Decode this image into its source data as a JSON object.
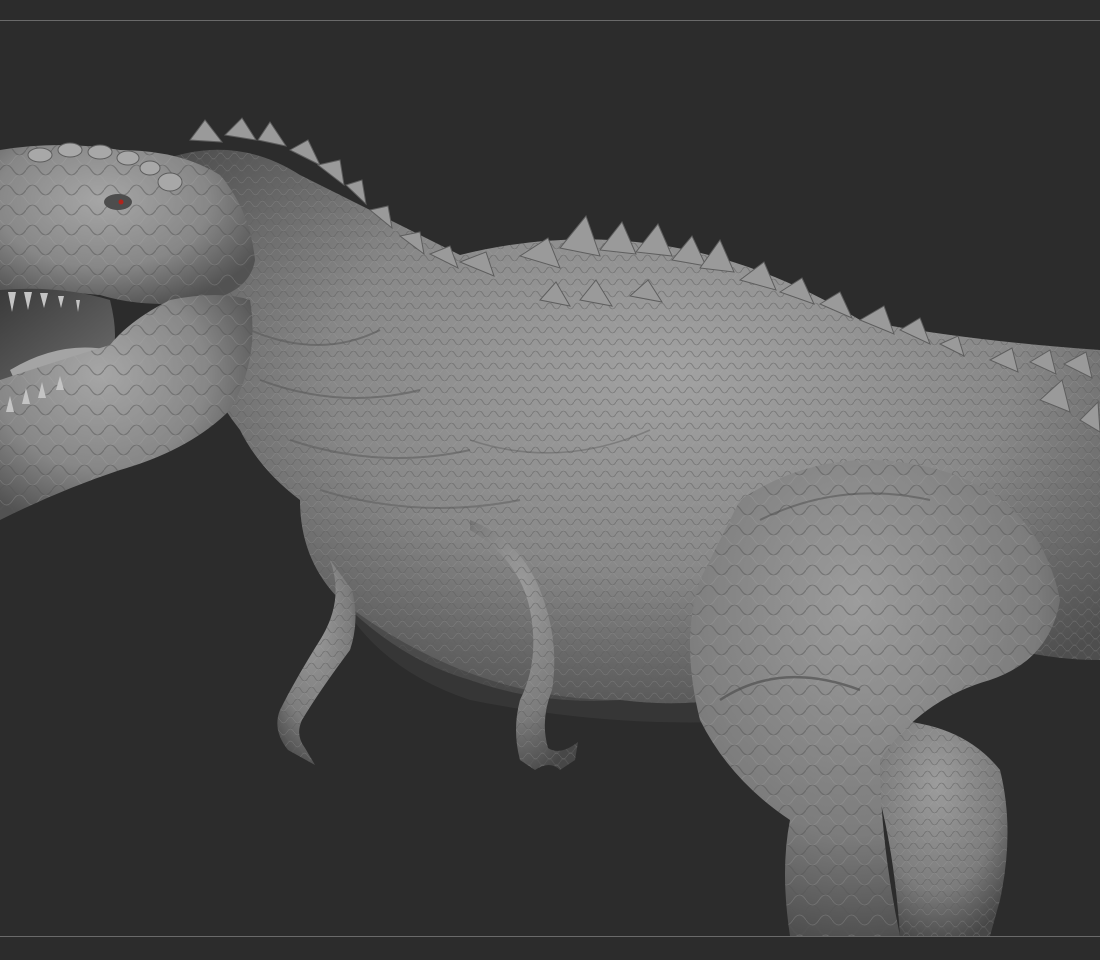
{
  "viewport": {
    "background_color": "#2c2c2c",
    "frame_line_color": "#6a6a6a"
  },
  "model": {
    "subject": "t-rex-sculpt",
    "material_color": "#8e8e8e",
    "eye_color": "#b0241c"
  }
}
